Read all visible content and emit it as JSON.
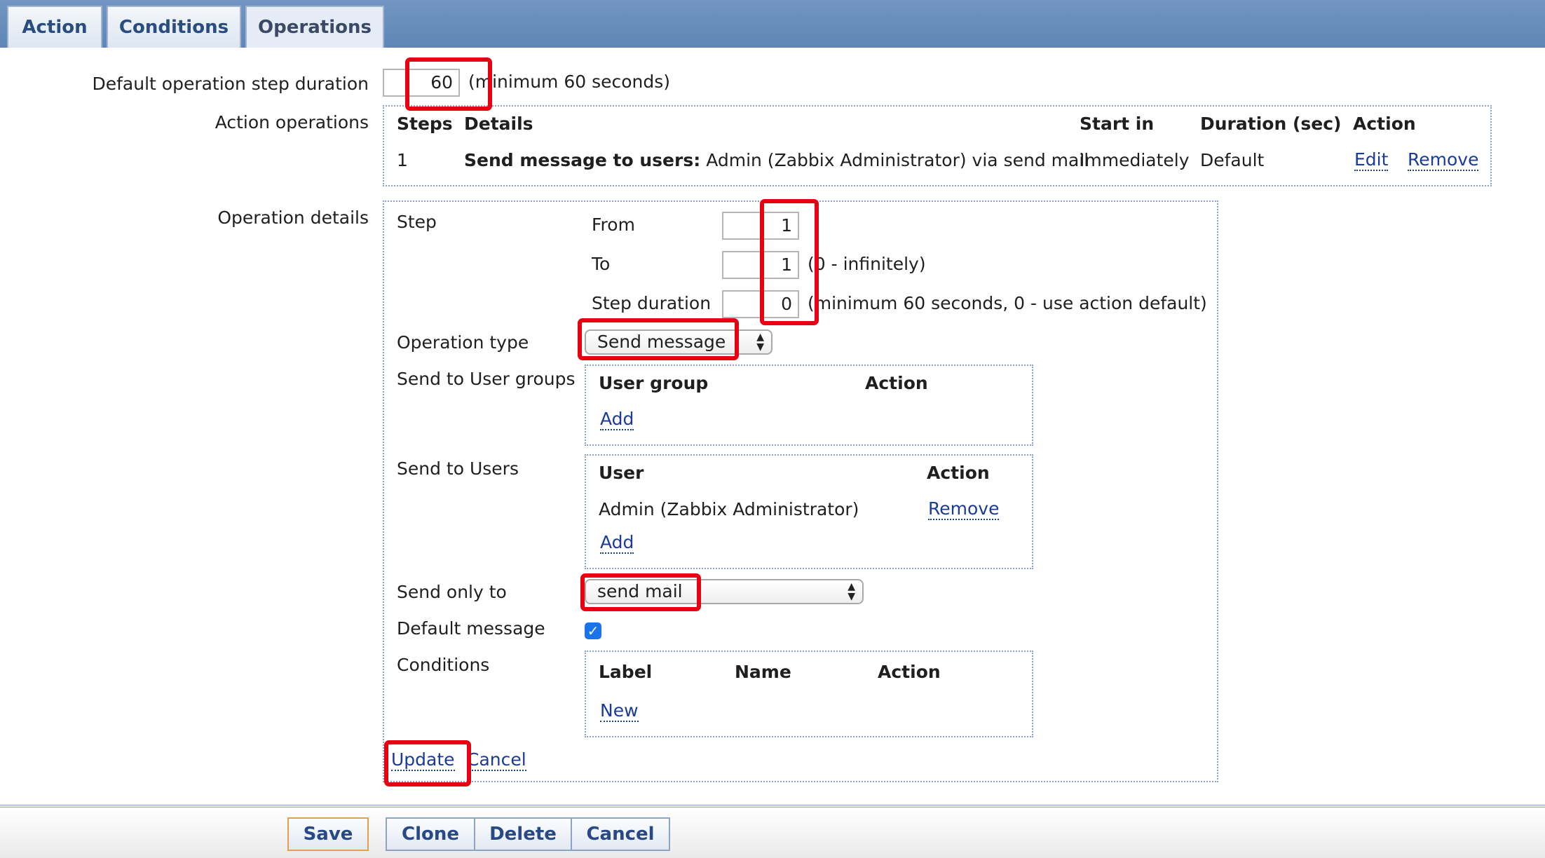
{
  "tabs": [
    {
      "label": "Action"
    },
    {
      "label": "Conditions"
    },
    {
      "label": "Operations"
    }
  ],
  "form": {
    "default_step_duration_label": "Default operation step duration",
    "default_step_duration_value": "60",
    "default_step_duration_hint": "(minimum 60 seconds)",
    "action_operations_label": "Action operations",
    "operation_details_label": "Operation details"
  },
  "operations_table": {
    "headers": [
      "Steps",
      "Details",
      "Start in",
      "Duration (sec)",
      "Action"
    ],
    "rows": [
      {
        "step": "1",
        "details_bold": "Send message to users:",
        "details_rest": "Admin (Zabbix Administrator) via send mail",
        "start_in": "Immediately",
        "duration": "Default",
        "edit": "Edit",
        "remove": "Remove"
      }
    ]
  },
  "details": {
    "step_label": "Step",
    "from_label": "From",
    "from_value": "1",
    "to_label": "To",
    "to_value": "1",
    "to_hint": "(0 - infinitely)",
    "step_duration_label": "Step duration",
    "step_duration_value": "0",
    "step_duration_hint": "(minimum 60 seconds, 0 - use action default)",
    "operation_type_label": "Operation type",
    "operation_type_value": "Send message",
    "user_groups_label": "Send to User groups",
    "user_groups_headers": [
      "User group",
      "Action"
    ],
    "user_groups_add": "Add",
    "users_label": "Send to Users",
    "users_headers": [
      "User",
      "Action"
    ],
    "users_rows": [
      {
        "name": "Admin (Zabbix Administrator)",
        "action": "Remove"
      }
    ],
    "users_add": "Add",
    "send_only_to_label": "Send only to",
    "send_only_to_value": "send mail",
    "default_message_label": "Default message",
    "default_message_checked": true,
    "conditions_label": "Conditions",
    "conditions_headers": [
      "Label",
      "Name",
      "Action"
    ],
    "conditions_new": "New",
    "update": "Update",
    "cancel": "Cancel"
  },
  "footer_buttons": {
    "save": "Save",
    "clone": "Clone",
    "delete": "Delete",
    "cancel": "Cancel"
  },
  "colors": {
    "highlight": "#e60012",
    "link": "#1c3b94",
    "tab_bar": "#6a8fbd",
    "checkbox": "#1a73e8"
  }
}
